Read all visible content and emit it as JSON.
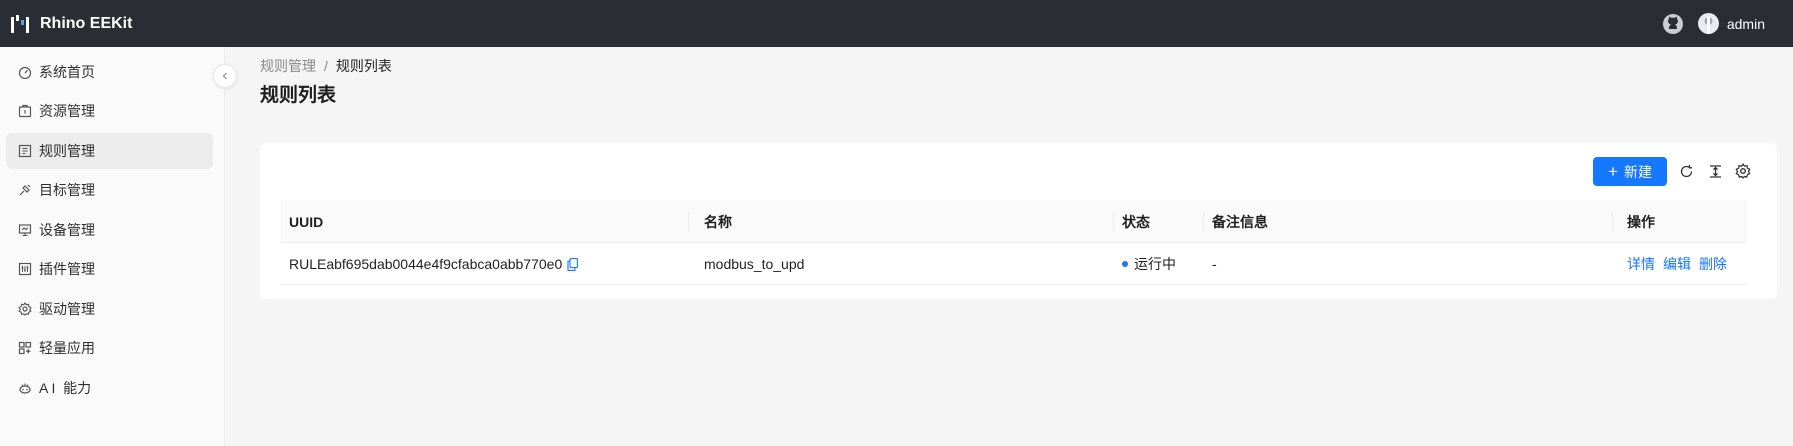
{
  "app": {
    "title": "Rhino EEKit"
  },
  "header": {
    "user": "admin",
    "icons": [
      "github-icon",
      "avatar"
    ]
  },
  "sidebar": {
    "items": [
      {
        "label": "系统首页",
        "icon": "dashboard-icon"
      },
      {
        "label": "资源管理",
        "icon": "resource-icon"
      },
      {
        "label": "规则管理",
        "icon": "rule-icon",
        "active": true
      },
      {
        "label": "目标管理",
        "icon": "target-icon"
      },
      {
        "label": "设备管理",
        "icon": "device-icon"
      },
      {
        "label": "插件管理",
        "icon": "plugin-icon"
      },
      {
        "label": "驱动管理",
        "icon": "gear-icon"
      },
      {
        "label": "轻量应用",
        "icon": "app-icon"
      },
      {
        "label": "A I  能力",
        "icon": "ai-icon"
      }
    ]
  },
  "breadcrumb": {
    "parent": "规则管理",
    "separator": "/",
    "current": "规则列表"
  },
  "page": {
    "title": "规则列表"
  },
  "toolbar": {
    "new_label": "新建",
    "icons": [
      "reload-icon",
      "column-height-icon",
      "setting-icon"
    ]
  },
  "table": {
    "headers": {
      "uuid": "UUID",
      "name": "名称",
      "status": "状态",
      "remark": "备注信息",
      "actions": "操作"
    },
    "rows": [
      {
        "uuid": "RULEabf695dab0044e4f9cfabca0abb770e0",
        "name": "modbus_to_upd",
        "status": "运行中",
        "remark": "-",
        "actions": {
          "detail": "详情",
          "edit": "编辑",
          "delete": "删除"
        }
      }
    ]
  },
  "colors": {
    "primary": "#1677ff",
    "header_bg": "#2a2d33",
    "status_running": "#1677ff"
  }
}
